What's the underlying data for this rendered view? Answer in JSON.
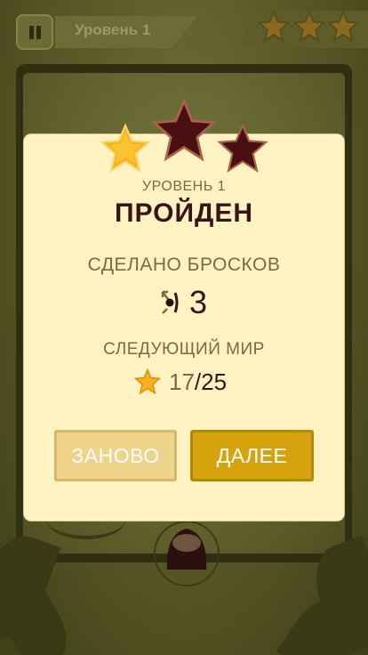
{
  "top_bar": {
    "level_title": "Уровень 1",
    "stars_earned": 3
  },
  "dialog": {
    "level_label": "УРОВЕНЬ 1",
    "status": "ПРОЙДЕН",
    "stars_earned": 1,
    "stars_total": 3,
    "throws_label": "СДЕЛАНО БРОСКОВ",
    "throws_value": "3",
    "next_world_label": "СЛЕДУЮЩИЙ МИР",
    "world_stars_current": "17",
    "world_stars_separator": "/",
    "world_stars_total": "25",
    "buttons": {
      "retry": "ЗАНОВО",
      "next": "ДАЛЕЕ"
    }
  },
  "colors": {
    "gold_star": "#f6b21e",
    "dark_star": "#4a0f12",
    "button_next": "#d4a30d",
    "button_retry": "#eed388",
    "dialog_bg": "#fff3c4"
  },
  "icons": {
    "throws": "target-arrow-icon",
    "world": "star-icon",
    "pause": "pause-icon"
  }
}
